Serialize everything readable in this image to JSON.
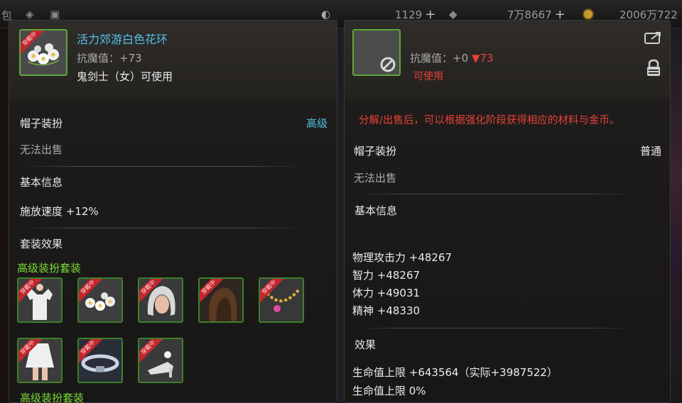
{
  "hud": {
    "stat1": "1129",
    "stat2": "7万8667",
    "stat3": "2006万722",
    "plus": "+"
  },
  "left_panel": {
    "item_name": "活力郊游白色花环",
    "resist_line": "抗魔值：+73",
    "class_line": "鬼剑士（女）可使用",
    "equipped_badge": "穿戴中",
    "category": "帽子装扮",
    "grade": "高级",
    "untradeable": "无法出售",
    "basic_info_header": "基本信息",
    "basic_stat": "施放速度 +12%",
    "set_effect_header": "套装效果",
    "set_name": "高级装扮套装",
    "set_name_bottom": "高级装扮套装",
    "set_items": [
      {
        "name": "dress-top",
        "badge": "穿戴中"
      },
      {
        "name": "flower-wreath",
        "badge": "穿戴中"
      },
      {
        "name": "hair",
        "badge": "穿戴中"
      },
      {
        "name": "face",
        "badge": "穿戴中"
      },
      {
        "name": "necklace",
        "badge": "穿戴中"
      },
      {
        "name": "skirt",
        "badge": "穿戴中"
      },
      {
        "name": "belt",
        "badge": "穿戴中"
      },
      {
        "name": "shoes",
        "badge": "穿戴中"
      }
    ]
  },
  "right_panel": {
    "resist_prefix": "抗魔值：+0",
    "resist_delta": "▼73",
    "usable": "可使用",
    "notice": "分解/出售后，可以根据强化阶段获得相应的材料与金币。",
    "category": "帽子装扮",
    "grade": "普通",
    "untradeable": "无法出售",
    "basic_info_header": "基本信息",
    "stats": [
      "物理攻击力 +48267",
      "智力 +48267",
      "体力 +49031",
      "精神 +48330"
    ],
    "effect_header": "效果",
    "effects": [
      "生命值上限 +643564（实际+3987522）",
      "生命值上限 0%"
    ]
  },
  "colors": {
    "title": "#57c0e8",
    "grade_high": "#57c0e8",
    "set_green": "#7ddc3a",
    "warning_red": "#e8413a",
    "frame_green": "#5ea83a"
  }
}
